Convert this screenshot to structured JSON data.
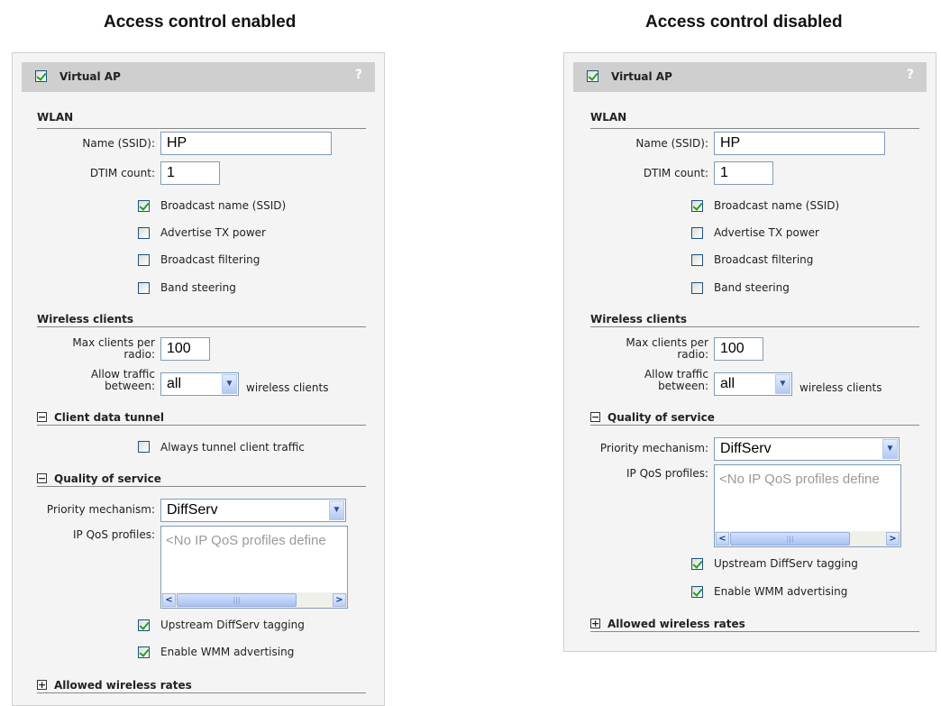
{
  "headings": {
    "left": "Access control enabled",
    "right": "Access control disabled"
  },
  "panel": {
    "title": "Virtual AP",
    "help": "?"
  },
  "wlan": {
    "section": "WLAN",
    "name_label": "Name (SSID):",
    "name_value": "HP",
    "dtim_label": "DTIM count:",
    "dtim_value": "1",
    "options": [
      {
        "label": "Broadcast name (SSID)",
        "checked": true
      },
      {
        "label": "Advertise TX power",
        "checked": false
      },
      {
        "label": "Broadcast filtering",
        "checked": false
      },
      {
        "label": "Band steering",
        "checked": false
      }
    ]
  },
  "wireless_clients": {
    "section": "Wireless clients",
    "max_label_1": "Max clients per",
    "max_label_2": "radio:",
    "max_value": "100",
    "allow_label_1": "Allow traffic",
    "allow_label_2": "between:",
    "allow_value": "all",
    "allow_suffix": "wireless clients"
  },
  "client_tunnel": {
    "section": "Client data tunnel",
    "toggle": "−",
    "option": "Always tunnel client traffic"
  },
  "qos": {
    "section": "Quality of service",
    "toggle": "−",
    "priority_label": "Priority mechanism:",
    "priority_value": "DiffServ",
    "profiles_label": "IP QoS profiles:",
    "profiles_placeholder": "<No IP QoS profiles define",
    "upstream": "Upstream DiffServ tagging",
    "wmm": "Enable WMM advertising"
  },
  "rates": {
    "section": "Allowed wireless rates",
    "toggle": "+"
  },
  "icons": {
    "dropdown": "chevron-down-icon",
    "scroll_left": "arrow-left-icon",
    "scroll_right": "arrow-right-icon"
  }
}
